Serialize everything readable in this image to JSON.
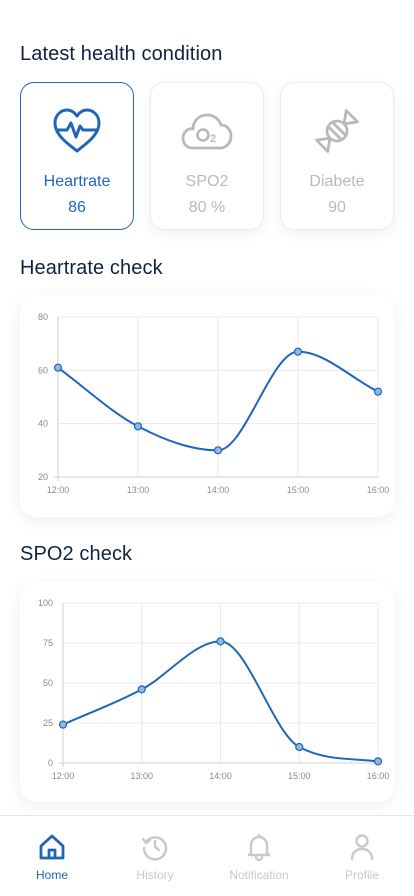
{
  "header": {
    "title": "Latest health condition"
  },
  "cards": [
    {
      "label": "Heartrate",
      "value": "86",
      "icon": "heart-pulse-icon",
      "active": true
    },
    {
      "label": "SPO2",
      "value": "80 %",
      "icon": "o2-cloud-icon",
      "active": false
    },
    {
      "label": "Diabete",
      "value": "90",
      "icon": "candy-icon",
      "active": false
    }
  ],
  "heartrate_section": {
    "title": "Heartrate check"
  },
  "spo2_section": {
    "title": "SPO2 check"
  },
  "colors": {
    "accent": "#1f66b8",
    "inactive": "#b9b9b9",
    "title": "#0f2244",
    "point_fill": "#8fb8e6"
  },
  "chart_data": [
    {
      "type": "line",
      "title": "",
      "x": [
        "12:00",
        "13:00",
        "14:00",
        "15:00",
        "16:00"
      ],
      "series": [
        {
          "values": [
            61,
            39,
            30,
            67,
            52
          ]
        }
      ],
      "ylim": [
        20,
        80
      ],
      "yticks": [
        20,
        40,
        60,
        80
      ],
      "grid": true
    },
    {
      "type": "line",
      "title": "",
      "x": [
        "12:00",
        "13:00",
        "14:00",
        "15:00",
        "16:00"
      ],
      "series": [
        {
          "values": [
            24,
            46,
            76,
            10,
            1
          ]
        }
      ],
      "ylim": [
        0,
        100
      ],
      "yticks": [
        0,
        25,
        50,
        75,
        100
      ],
      "grid": true
    }
  ],
  "nav": [
    {
      "label": "Home",
      "icon": "home-icon",
      "active": true
    },
    {
      "label": "History",
      "icon": "history-icon",
      "active": false
    },
    {
      "label": "Notification",
      "icon": "bell-icon",
      "active": false
    },
    {
      "label": "Profile",
      "icon": "user-icon",
      "active": false
    }
  ]
}
